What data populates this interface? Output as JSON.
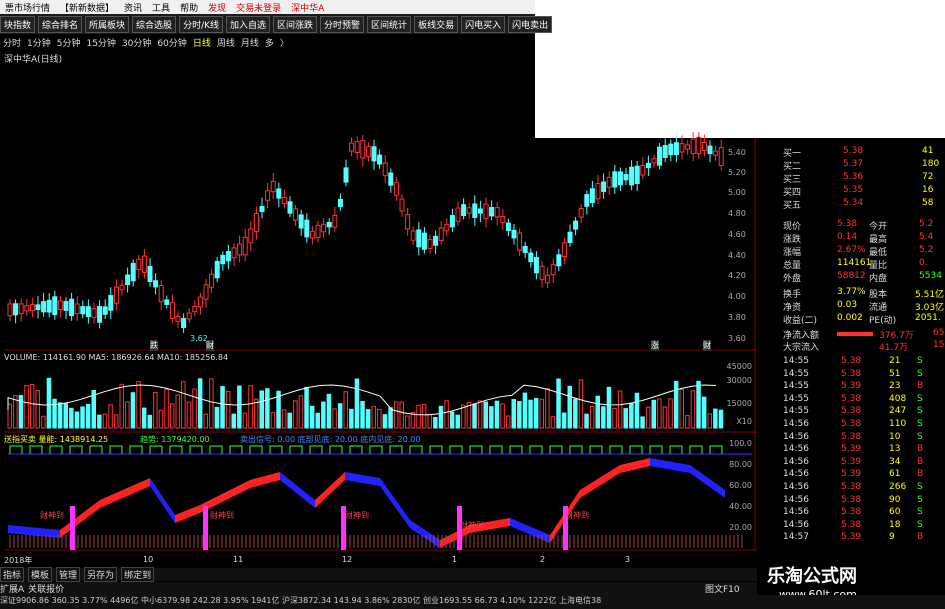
{
  "menubar": {
    "items": [
      "票市场行情",
      "【新新数据】",
      "资讯",
      "工具",
      "帮助",
      "发现",
      "交易未登录",
      "深中华A"
    ]
  },
  "toolbar": {
    "buttons": [
      "块指数",
      "综合排名",
      "所属板块",
      "综合选股",
      "分时/K线",
      "加入自选",
      "区间涨跌",
      "分时预警",
      "区间统计",
      "板线交易",
      "闪电买入",
      "闪电卖出"
    ]
  },
  "periods": {
    "items": [
      "分时",
      "1分钟",
      "5分钟",
      "15分钟",
      "30分钟",
      "60分钟",
      "日线",
      "周线",
      "月线",
      "多",
      "〉"
    ],
    "selected": "日线"
  },
  "chart": {
    "title": "深中华A(日线)",
    "low_label": "3.62",
    "price_ticks": [
      "5.40",
      "5.20",
      "5.00",
      "4.80",
      "4.60",
      "4.40",
      "4.20",
      "4.00",
      "3.80",
      "3.60"
    ],
    "vol_header": "VOLUME: 114161.90  MA5: 186926.64  MA10: 185256.84",
    "vol_ticks": [
      "45000",
      "30000",
      "15000",
      "X10"
    ],
    "ind_header": "送指买卖  量能: 1438914.25",
    "ind_header2": "趋势: 1379420.00",
    "ind_header3": "卖出信号: 0.00   底部见底: 20.00   底内见底: 20.00",
    "ind_ticks": [
      "100.0",
      "80.00",
      "60.00",
      "40.00",
      "20.00"
    ],
    "marks": [
      "财神到",
      "财神到",
      "财神到",
      "财神到",
      "财神到"
    ],
    "x_labels": [
      "2018年",
      "10",
      "11",
      "12",
      "1",
      "2",
      "3"
    ],
    "markers": [
      "跌",
      "财",
      "涨",
      "财"
    ]
  },
  "quotes": {
    "asks": [
      {
        "label": "买一",
        "price": "5.38",
        "vol": "41"
      },
      {
        "label": "买二",
        "price": "5.37",
        "vol": "180"
      },
      {
        "label": "买三",
        "price": "5.36",
        "vol": "72"
      },
      {
        "label": "买四",
        "price": "5.35",
        "vol": "16"
      },
      {
        "label": "买五",
        "price": "5.34",
        "vol": "58"
      }
    ],
    "stats": [
      {
        "k1": "现价",
        "v1": "5.38",
        "k2": "今开",
        "v2": "5.2"
      },
      {
        "k1": "涨跌",
        "v1": "0.14",
        "k2": "最高",
        "v2": "5.4"
      },
      {
        "k1": "涨幅",
        "v1": "2.67%",
        "k2": "最低",
        "v2": "5.2"
      },
      {
        "k1": "总量",
        "v1": "114161",
        "k2": "量比",
        "v2": "0."
      },
      {
        "k1": "外盘",
        "v1": "58812",
        "k2": "内盘",
        "v2": "5534"
      }
    ],
    "stats2": [
      {
        "k1": "换手",
        "v1": "3.77%",
        "k2": "股本",
        "v2": "5.51亿"
      },
      {
        "k1": "净资",
        "v1": "0.03",
        "k2": "流通",
        "v2": "3.03亿"
      },
      {
        "k1": "收益(二)",
        "v1": "0.002",
        "k2": "PE(动)",
        "v2": "2051."
      }
    ],
    "flows": [
      {
        "k": "净流入额",
        "v": "376.7万",
        "v2": "65"
      },
      {
        "k": "大宗流入",
        "v": "41.7万",
        "v2": "15"
      }
    ],
    "ticks": [
      {
        "t": "14:55",
        "p": "5.38",
        "v": "21",
        "s": "S"
      },
      {
        "t": "14:55",
        "p": "5.38",
        "v": "51",
        "s": "S"
      },
      {
        "t": "14:55",
        "p": "5.39",
        "v": "23",
        "s": "B"
      },
      {
        "t": "14:55",
        "p": "5.38",
        "v": "408",
        "s": "S"
      },
      {
        "t": "14:55",
        "p": "5.38",
        "v": "247",
        "s": "S"
      },
      {
        "t": "14:56",
        "p": "5.38",
        "v": "110",
        "s": "S"
      },
      {
        "t": "14:56",
        "p": "5.38",
        "v": "10",
        "s": "S"
      },
      {
        "t": "14:56",
        "p": "5.39",
        "v": "13",
        "s": "B"
      },
      {
        "t": "14:56",
        "p": "5.39",
        "v": "34",
        "s": "B"
      },
      {
        "t": "14:56",
        "p": "5.39",
        "v": "61",
        "s": "B"
      },
      {
        "t": "14:56",
        "p": "5.38",
        "v": "266",
        "s": "S"
      },
      {
        "t": "14:56",
        "p": "5.38",
        "v": "90",
        "s": "S"
      },
      {
        "t": "14:56",
        "p": "5.38",
        "v": "60",
        "s": "S"
      },
      {
        "t": "14:56",
        "p": "5.38",
        "v": "18",
        "s": "S"
      },
      {
        "t": "14:57",
        "p": "5.39",
        "v": "9",
        "s": "B"
      }
    ]
  },
  "tabs": [
    "指标",
    "模板",
    "管理",
    "另存为",
    "绑定到"
  ],
  "tabs2": [
    "扩展A",
    "关联报价"
  ],
  "status_right": "图文F10",
  "bottom": "深证9906.86 360.35 3.77% 4496亿  中小6379.98 242.28 3.95% 1941亿  沪深3872.34 143.94 3.86% 2830亿  创业1693.55 66.73 4.10% 1222亿  上海电信38",
  "watermark": {
    "line1": "乐淘公式网",
    "line2": "www.60lt.com"
  },
  "colors": {
    "up": "#ff3333",
    "down": "#33ffff",
    "bg": "#000000",
    "grid": "#800000"
  }
}
